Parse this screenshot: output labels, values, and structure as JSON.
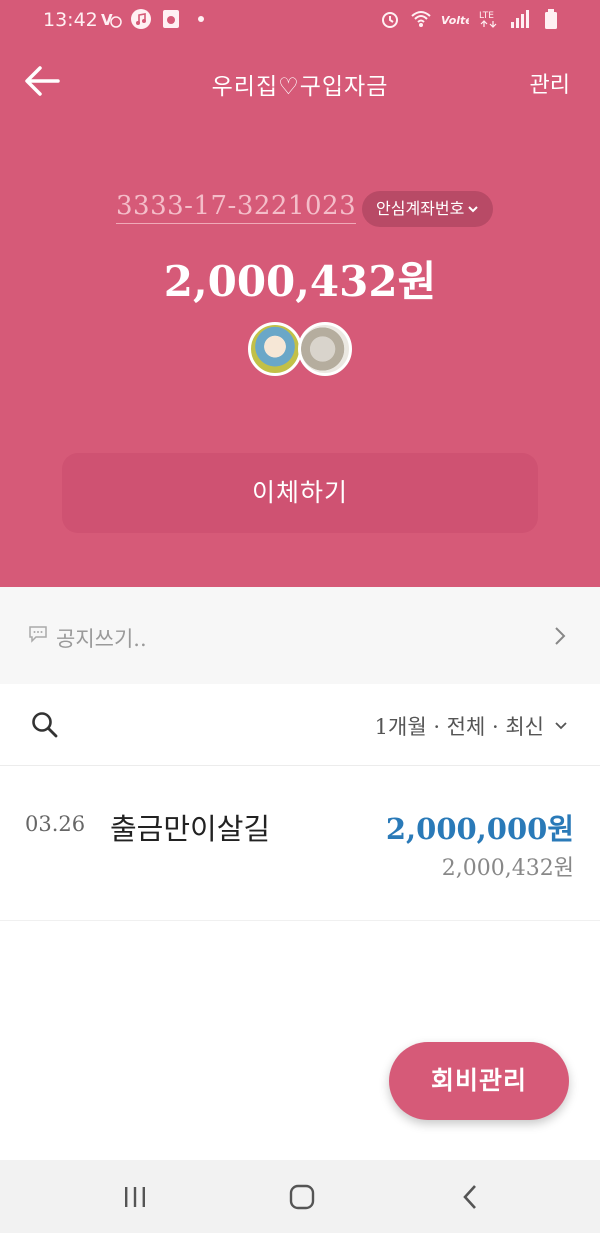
{
  "status_bar": {
    "time": "13:42",
    "icons_left": [
      "volte-icon",
      "music-icon",
      "gallery-icon",
      "dot-icon"
    ],
    "icons_right": [
      "alarm-icon",
      "wifi-icon",
      "volte-icon",
      "lte-icon",
      "signal-icon",
      "battery-icon"
    ]
  },
  "app_bar": {
    "title": "우리집♡구입자금",
    "manage_label": "관리"
  },
  "account": {
    "number": "3333-17-3221023",
    "safe_number_label": "안심계좌번호",
    "balance": "2,000,432원"
  },
  "actions": {
    "transfer_label": "이체하기"
  },
  "notice": {
    "placeholder": "공지쓰기.."
  },
  "filter": {
    "label": "1개월 · 전체 · 최신"
  },
  "transactions": [
    {
      "date": "03.26",
      "description": "출금만이살길",
      "amount": "2,000,000원",
      "balance_after": "2,000,432원"
    }
  ],
  "fab": {
    "label": "회비관리"
  },
  "colors": {
    "header_bg": "#d65a78",
    "amount_blue": "#2a7ab8"
  }
}
